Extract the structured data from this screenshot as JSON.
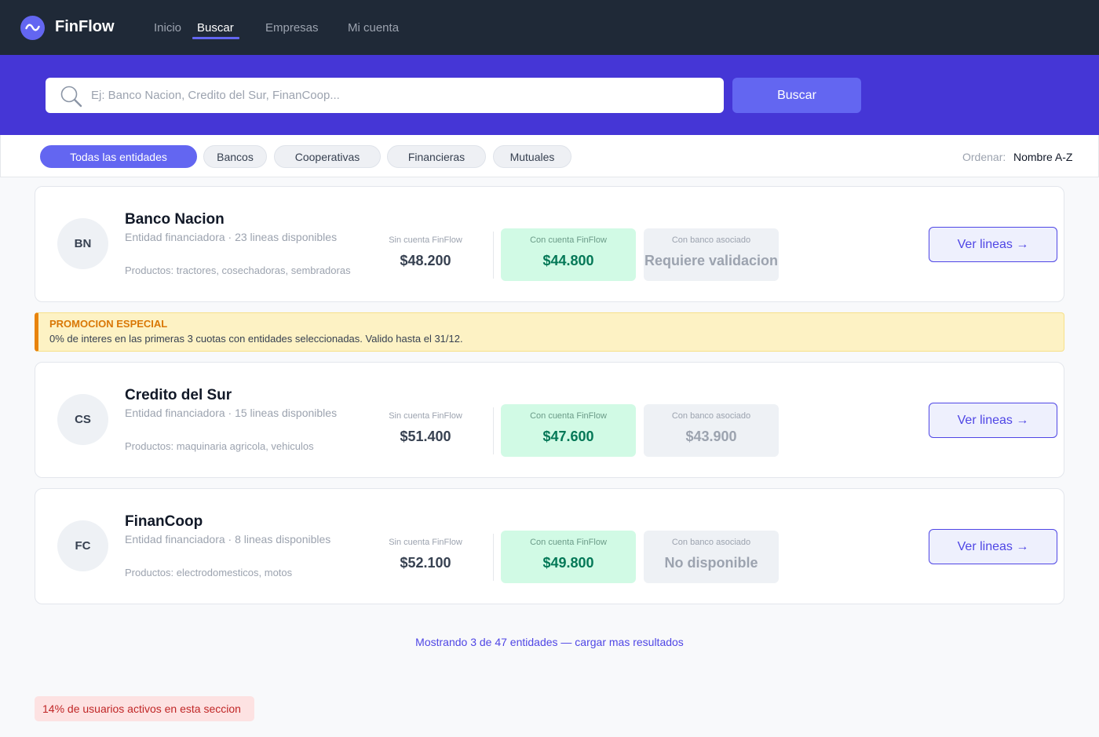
{
  "app": {
    "brand": "FinFlow"
  },
  "nav": {
    "items": [
      {
        "label": "Inicio"
      },
      {
        "label": "Buscar"
      },
      {
        "label": "Empresas"
      },
      {
        "label": "Mi cuenta"
      }
    ]
  },
  "search": {
    "placeholder": "Ej: Banco Nacion, Credito del Sur, FinanCoop...",
    "value": "",
    "button_label": "Buscar"
  },
  "filters": {
    "chips": [
      {
        "label": "Todas las entidades",
        "active": true
      },
      {
        "label": "Bancos",
        "active": false
      },
      {
        "label": "Cooperativas",
        "active": false
      },
      {
        "label": "Financieras",
        "active": false
      },
      {
        "label": "Mutuales",
        "active": false
      }
    ],
    "sort_label": "Ordenar:",
    "sort_value": "Nombre A-Z"
  },
  "price_labels": {
    "no_account": "Sin cuenta FinFlow",
    "with_account": "Con cuenta FinFlow",
    "with_bank": "Con banco asociado"
  },
  "entities": [
    {
      "initials": "BN",
      "name": "Banco Nacion",
      "subtitle": "Entidad financiadora · 23 lineas disponibles",
      "products": "Productos: tractores, cosechadoras, sembradoras",
      "price_no_account": "$48.200",
      "price_with_account": "$44.800",
      "price_with_bank": "Requiere validacion",
      "button_label": "Ver lineas →"
    },
    {
      "initials": "CS",
      "name": "Credito del Sur",
      "subtitle": "Entidad financiadora · 15 lineas disponibles",
      "products": "Productos: maquinaria agricola, vehiculos",
      "price_no_account": "$51.400",
      "price_with_account": "$47.600",
      "price_with_bank": "$43.900",
      "button_label": "Ver lineas →"
    },
    {
      "initials": "FC",
      "name": "FinanCoop",
      "subtitle": "Entidad financiadora · 8 lineas disponibles",
      "products": "Productos: electrodomesticos, motos",
      "price_no_account": "$52.100",
      "price_with_account": "$49.800",
      "price_with_bank": "No disponible",
      "button_label": "Ver lineas →"
    }
  ],
  "promo": {
    "title": "PROMOCION ESPECIAL",
    "text": "0% de interes en las primeras 3 cuotas con entidades seleccionadas. Valido hasta el 31/12."
  },
  "load_more": "Mostrando 3 de 47 entidades — cargar mas resultados",
  "active_users": "14% de usuarios activos en esta seccion",
  "colors": {
    "nav_bg": "#1f2937",
    "banner_bg": "#4536d6",
    "accent": "#6366f1",
    "green_bg": "#d1fae5",
    "green_text": "#047857",
    "promo_bg": "#fdf2c4",
    "promo_accent": "#e8830c",
    "alert_bg": "#fde2e2",
    "alert_text": "#c02626"
  }
}
